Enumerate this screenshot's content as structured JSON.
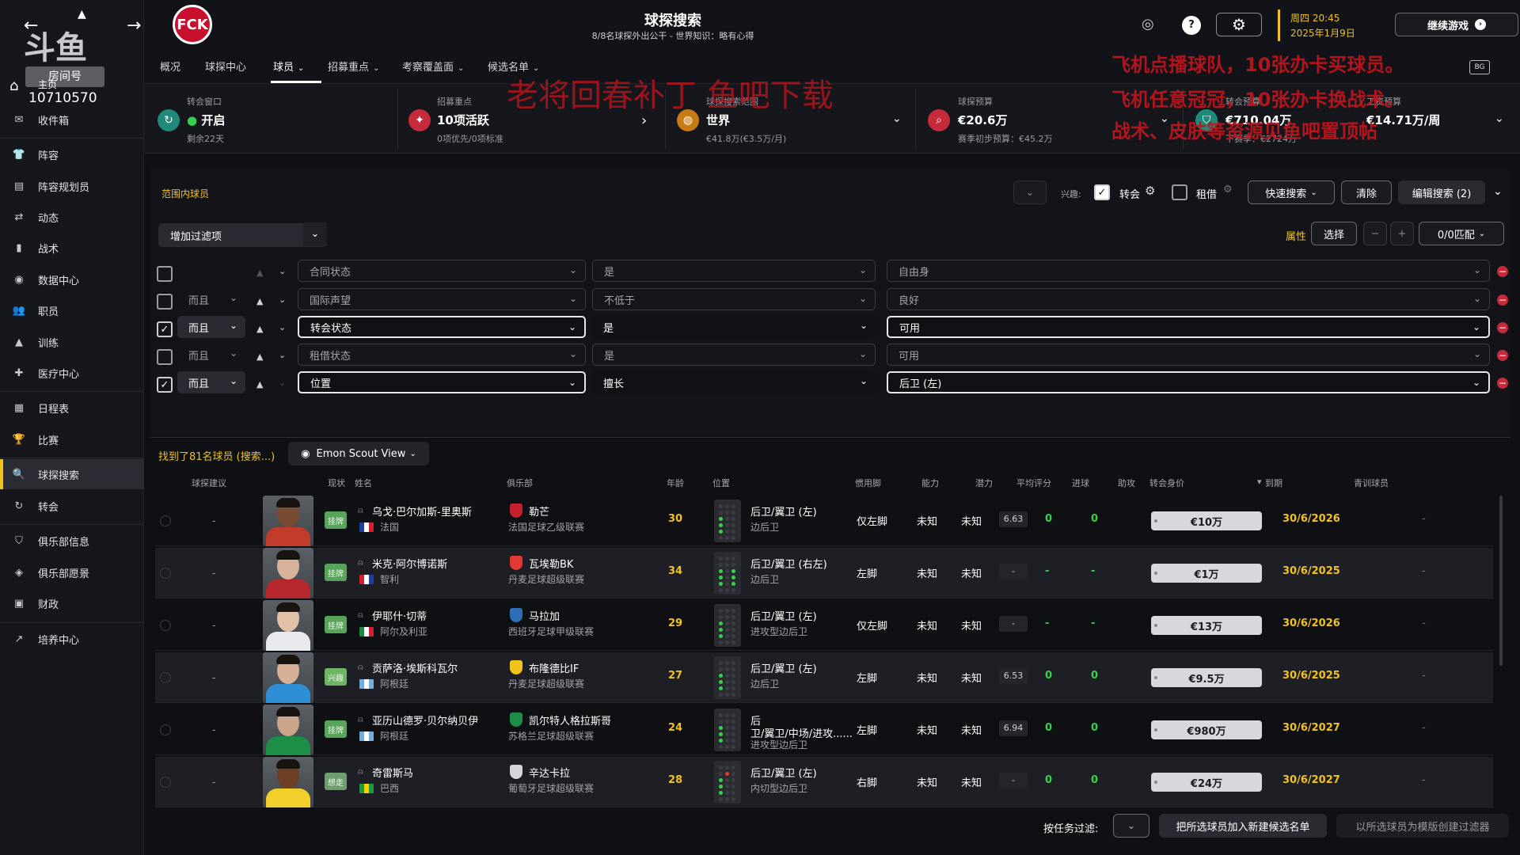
{
  "header": {
    "title": "球探搜索",
    "subtitle": "8/8名球探外出公干 - 世界知识：略有心得",
    "date_line1": "周四 20:45",
    "date_line2": "2025年1月9日",
    "continue_label": "继续游戏"
  },
  "tabs": [
    {
      "label": "概况"
    },
    {
      "label": "球探中心"
    },
    {
      "label": "球员"
    },
    {
      "label": "招募重点"
    },
    {
      "label": "考察覆盖面"
    },
    {
      "label": "候选名单"
    }
  ],
  "sidebar": {
    "items": [
      {
        "label": "收件箱"
      },
      {
        "label": "阵容"
      },
      {
        "label": "阵容规划员"
      },
      {
        "label": "动态"
      },
      {
        "label": "战术"
      },
      {
        "label": "数据中心"
      },
      {
        "label": "职员"
      },
      {
        "label": "训练"
      },
      {
        "label": "医疗中心"
      },
      {
        "label": "日程表"
      },
      {
        "label": "比赛"
      },
      {
        "label": "球探搜索"
      },
      {
        "label": "转会"
      },
      {
        "label": "俱乐部信息"
      },
      {
        "label": "俱乐部愿景"
      },
      {
        "label": "财政"
      },
      {
        "label": "培养中心"
      }
    ]
  },
  "overlay": {
    "room_label": "房间号",
    "room_number": "10710570",
    "logo_text": "斗鱼",
    "top_text": "主页"
  },
  "stats": {
    "transfer_window": {
      "label": "转会窗口",
      "value": "开启",
      "sub": "剩余22天"
    },
    "recruit": {
      "label": "招募重点",
      "value": "10项活跃",
      "sub": "0项优先/0项标准"
    },
    "range": {
      "label": "球探搜索范围",
      "value": "世界",
      "sub": "€41.8万(€3.5万/月)"
    },
    "budget": {
      "label": "球探预算",
      "value": "€20.6万",
      "sub": "赛季初步预算：€45.2万"
    },
    "transfer_budget": {
      "label": "转会预算",
      "value": "€710.04万",
      "sub": "下赛季：€2724万"
    },
    "wage_budget": {
      "label": "工资预算",
      "value": "€14.71万/周"
    }
  },
  "watermarks": {
    "w1": "老将回春补丁  鱼吧下载",
    "w2": "飞机点播球队，10张办卡买球员。",
    "w3": "飞机任意冠冠，10张办卡换战术。",
    "w4": "战术、皮肤等资源见鱼吧置顶帖"
  },
  "filterbar": {
    "section_label": "范围内球员",
    "interest_label": "兴趣:",
    "transfer_label": "转会",
    "loan_label": "租借",
    "quick_search": "快速搜索",
    "clear": "清除",
    "edit_search": "编辑搜索 (2)",
    "add_filter": "增加过滤项",
    "attr_label": "属性",
    "select_label": "选择",
    "match_label": "0/0匹配"
  },
  "filters": [
    {
      "checked": false,
      "conj": "",
      "field": "合同状态",
      "op": "是",
      "value": "自由身",
      "active": false
    },
    {
      "checked": false,
      "conj": "而且",
      "field": "国际声望",
      "op": "不低于",
      "value": "良好",
      "active": false
    },
    {
      "checked": true,
      "conj": "而且",
      "field": "转会状态",
      "op": "是",
      "value": "可用",
      "active": true
    },
    {
      "checked": false,
      "conj": "而且",
      "field": "租借状态",
      "op": "是",
      "value": "可用",
      "active": false
    },
    {
      "checked": true,
      "conj": "而且",
      "field": "位置",
      "op": "擅长",
      "value": "后卫 (左)",
      "active": true
    }
  ],
  "results": {
    "found": "找到了81名球员 (搜索...)",
    "view": "Emon Scout View"
  },
  "columns": {
    "advice": "球探建议",
    "status": "现状",
    "name": "姓名",
    "club": "俱乐部",
    "age": "年龄",
    "position": "位置",
    "foot": "惯用脚",
    "ability": "能力",
    "potential": "潜力",
    "avg": "平均评分",
    "goals": "进球",
    "assists": "助攻",
    "value": "转会身价",
    "expires": "到期",
    "youth": "青训球员"
  },
  "players": [
    {
      "advice": "-",
      "status": "挂牌",
      "name": "乌戈·巴尔加斯-里奥斯",
      "nation": "法国",
      "club": "勒芒",
      "league": "法国足球乙级联赛",
      "age": "30",
      "pos1": "后卫/翼卫 (左)",
      "pos2": "边后卫",
      "foot": "仅左脚",
      "ability": "未知",
      "potential": "未知",
      "avg": "6.63",
      "goals": "0",
      "assists": "0",
      "value": "€10万",
      "expires": "30/6/2026",
      "youth": "-"
    },
    {
      "advice": "-",
      "status": "挂牌",
      "name": "米克·阿尔博诺斯",
      "nation": "智利",
      "club": "瓦埃勒BK",
      "league": "丹麦足球超级联赛",
      "age": "34",
      "pos1": "后卫/翼卫 (右左)",
      "pos2": "边后卫",
      "foot": "左脚",
      "ability": "未知",
      "potential": "未知",
      "avg": "-",
      "goals": "-",
      "assists": "-",
      "value": "€1万",
      "expires": "30/6/2025",
      "youth": "-"
    },
    {
      "advice": "-",
      "status": "挂牌",
      "name": "伊耶什·切蒂",
      "nation": "阿尔及利亚",
      "club": "马拉加",
      "league": "西班牙足球甲级联赛",
      "age": "29",
      "pos1": "后卫/翼卫 (左)",
      "pos2": "进攻型边后卫",
      "foot": "仅左脚",
      "ability": "未知",
      "potential": "未知",
      "avg": "-",
      "goals": "-",
      "assists": "-",
      "value": "€13万",
      "expires": "30/6/2026",
      "youth": "-"
    },
    {
      "advice": "-",
      "status": "兴趣",
      "name": "贡萨洛·埃斯科瓦尔",
      "nation": "阿根廷",
      "club": "布隆德比IF",
      "league": "丹麦足球超级联赛",
      "age": "27",
      "pos1": "后卫/翼卫 (左)",
      "pos2": "边后卫",
      "foot": "左脚",
      "ability": "未知",
      "potential": "未知",
      "avg": "6.53",
      "goals": "0",
      "assists": "0",
      "value": "€9.5万",
      "expires": "30/6/2025",
      "youth": "-"
    },
    {
      "advice": "-",
      "status": "挂牌",
      "name": "亚历山德罗·贝尔纳贝伊",
      "nation": "阿根廷",
      "club": "凯尔特人格拉斯哥",
      "league": "苏格兰足球超级联赛",
      "age": "24",
      "pos1": "后",
      "pos1b": "卫/翼卫/中场/进攻......",
      "pos2": "进攻型边后卫",
      "foot": "左脚",
      "ability": "未知",
      "potential": "未知",
      "avg": "6.94",
      "goals": "0",
      "assists": "0",
      "value": "€980万",
      "expires": "30/6/2027",
      "youth": "-"
    },
    {
      "advice": "-",
      "status": "想走",
      "name": "奇雷斯马",
      "nation": "巴西",
      "club": "辛达卡拉",
      "league": "葡萄牙足球超级联赛",
      "age": "28",
      "pos1": "后卫/翼卫 (左)",
      "pos2": "内切型边后卫",
      "foot": "右脚",
      "ability": "未知",
      "potential": "未知",
      "avg": "-",
      "goals": "0",
      "assists": "0",
      "value": "€24万",
      "expires": "30/6/2027",
      "youth": "-"
    }
  ],
  "footer": {
    "task_filter": "按任务过滤:",
    "add_shortlist": "把所选球员加入新建候选名单",
    "create_filter": "以所选球员为模版创建过滤器"
  }
}
